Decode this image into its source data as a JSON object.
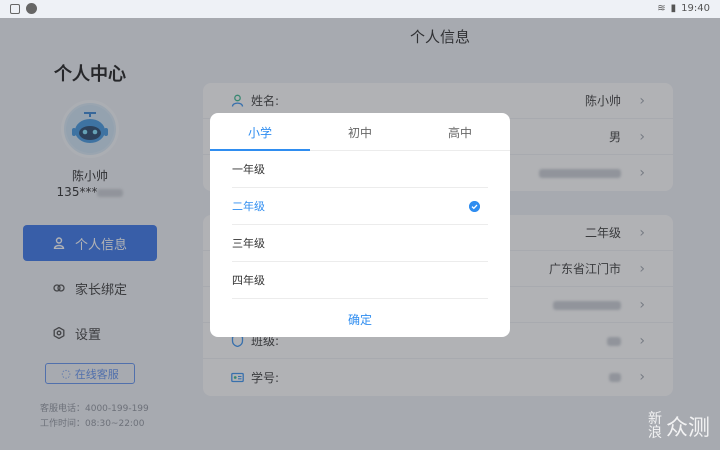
{
  "status_bar": {
    "time": "19:40"
  },
  "page_title": "个人信息",
  "sidebar": {
    "title": "个人中心",
    "user_name": "陈小帅",
    "phone_prefix": "135***",
    "nav": [
      {
        "label": "个人信息",
        "icon": "person-icon",
        "active": true
      },
      {
        "label": "家长绑定",
        "icon": "link-icon",
        "active": false
      },
      {
        "label": "设置",
        "icon": "gear-icon",
        "active": false
      }
    ],
    "service_button": "在线客服",
    "service_phone": "客服电话：4000-199-199",
    "service_hours": "工作时间：08:30~22:00"
  },
  "info_card_1": {
    "rows": [
      {
        "label": "姓名:",
        "value": "陈小帅",
        "icon": "person-icon"
      },
      {
        "label": "",
        "value": "男"
      },
      {
        "label": "",
        "value": ""
      }
    ]
  },
  "info_card_2": {
    "rows": [
      {
        "label": "",
        "value": "二年级"
      },
      {
        "label": "",
        "value": "广东省江门市"
      },
      {
        "label": "",
        "value": ""
      },
      {
        "label": "班级:",
        "value": "",
        "icon": "shield-icon"
      },
      {
        "label": "学号:",
        "value": "",
        "icon": "id-card-icon"
      }
    ]
  },
  "picker": {
    "tabs": [
      "小学",
      "初中",
      "高中"
    ],
    "active_tab": 0,
    "options": [
      "一年级",
      "二年级",
      "三年级",
      "四年级"
    ],
    "selected_index": 1,
    "confirm_label": "确定"
  },
  "watermark": {
    "cn": "新浪",
    "site": "众测"
  },
  "colors": {
    "accent": "#2f6fe8",
    "picker_accent": "#2f8df0"
  }
}
